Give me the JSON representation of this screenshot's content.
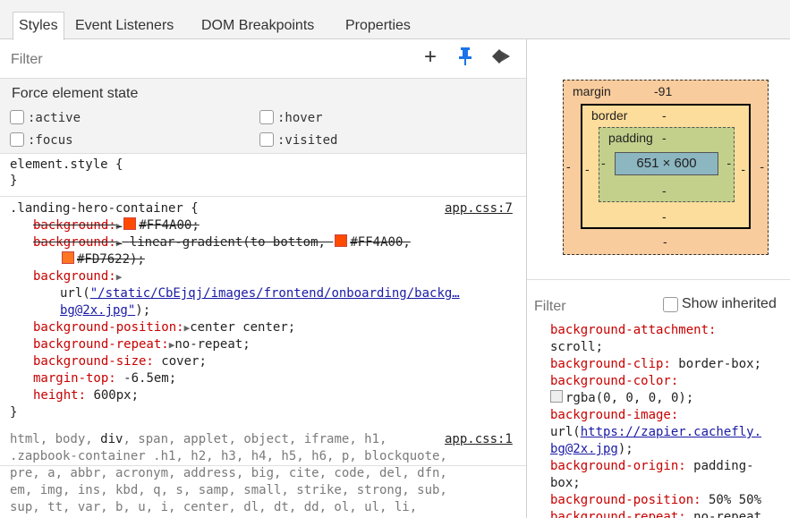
{
  "tabs": [
    "Styles",
    "Event Listeners",
    "DOM Breakpoints",
    "Properties"
  ],
  "styles_filter": {
    "placeholder": "Filter",
    "plus": "+",
    "pin": "📌",
    "diamond": "◆"
  },
  "force_state": {
    "title": "Force element state",
    "active": ":active",
    "hover": ":hover",
    "focus": ":focus",
    "visited": ":visited"
  },
  "element_style": {
    "open": "element.style {",
    "close": "}"
  },
  "rule1": {
    "selector": ".landing-hero-container {",
    "source": "app.css:7",
    "bg1_prop": "background:",
    "bg1_val": "#FF4A00;",
    "bg1_color": "#FF4A00",
    "bg2_prop": "background:",
    "bg2_val": "linear-gradient(to bottom,",
    "bg2_val2": "#FF4A00,",
    "bg2_val3": "#FD7622);",
    "bg2_color2": "#FD7622",
    "bg3_prop": "background:",
    "bg3_url_pre": "url(",
    "bg3_url": "\"/static/CbEjqj/images/frontend/onboarding/backg…",
    "bg3_url2": "bg@2x.jpg\"",
    "bg3_url_post": ");",
    "bgpos_prop": "background-position:",
    "bgpos_val": "center center;",
    "bgrep_prop": "background-repeat:",
    "bgrep_val": "no-repeat;",
    "bgsize_prop": "background-size:",
    "bgsize_val": "cover;",
    "mt_prop": "margin-top:",
    "mt_val": "-6.5em;",
    "h_prop": "height:",
    "h_val": "600px;",
    "close": "}"
  },
  "rule2": {
    "line1a": "html, body, ",
    "line1b": "div",
    "line1c": ", span, applet, object, iframe, h1, ",
    "source": "app.css:1",
    "line2": ".zapbook-container .h1, h2, h3, h4, h5, h6, p, blockquote,",
    "line3": "pre, a, abbr, acronym, address, big, cite, code, del, dfn,",
    "line4": "em, img, ins, kbd, q, s, samp, small, strike, strong, sub,",
    "line5": "sup, tt, var, b, u, i, center, dl, dt, dd, ol, ul, li,"
  },
  "box_model": {
    "margin_label": "margin",
    "margin_top": "-91",
    "margin_dash": "-",
    "border_label": "border",
    "border_dash": "-",
    "padding_label": "padding",
    "padding_dash": "-",
    "content": "651 × 600",
    "colors": {
      "margin": "#f9cc9d",
      "border": "#fddd9b",
      "padding": "#c3d08b",
      "content": "#8cb6c0"
    }
  },
  "computed_filter": {
    "placeholder": "Filter",
    "show_inherited": "Show inherited"
  },
  "computed": {
    "l1": "background-attachment:",
    "l2": "scroll;",
    "l3p": "background-clip:",
    "l3v": " border-box;",
    "l4": "background-color:",
    "l5": "rgba(0, 0, 0, 0);",
    "l6": "background-image:",
    "l7a": "url(",
    "l7b": "https://zapier.cachefly.",
    "l8a": "bg@2x.jpg",
    "l8b": ");",
    "l9p": "background-origin:",
    "l9v": " padding-",
    "l10": "box;",
    "l11p": "background-position:",
    "l11v": " 50% 50%",
    "l12p": "background-repeat:",
    "l12v": " no-repeat"
  }
}
